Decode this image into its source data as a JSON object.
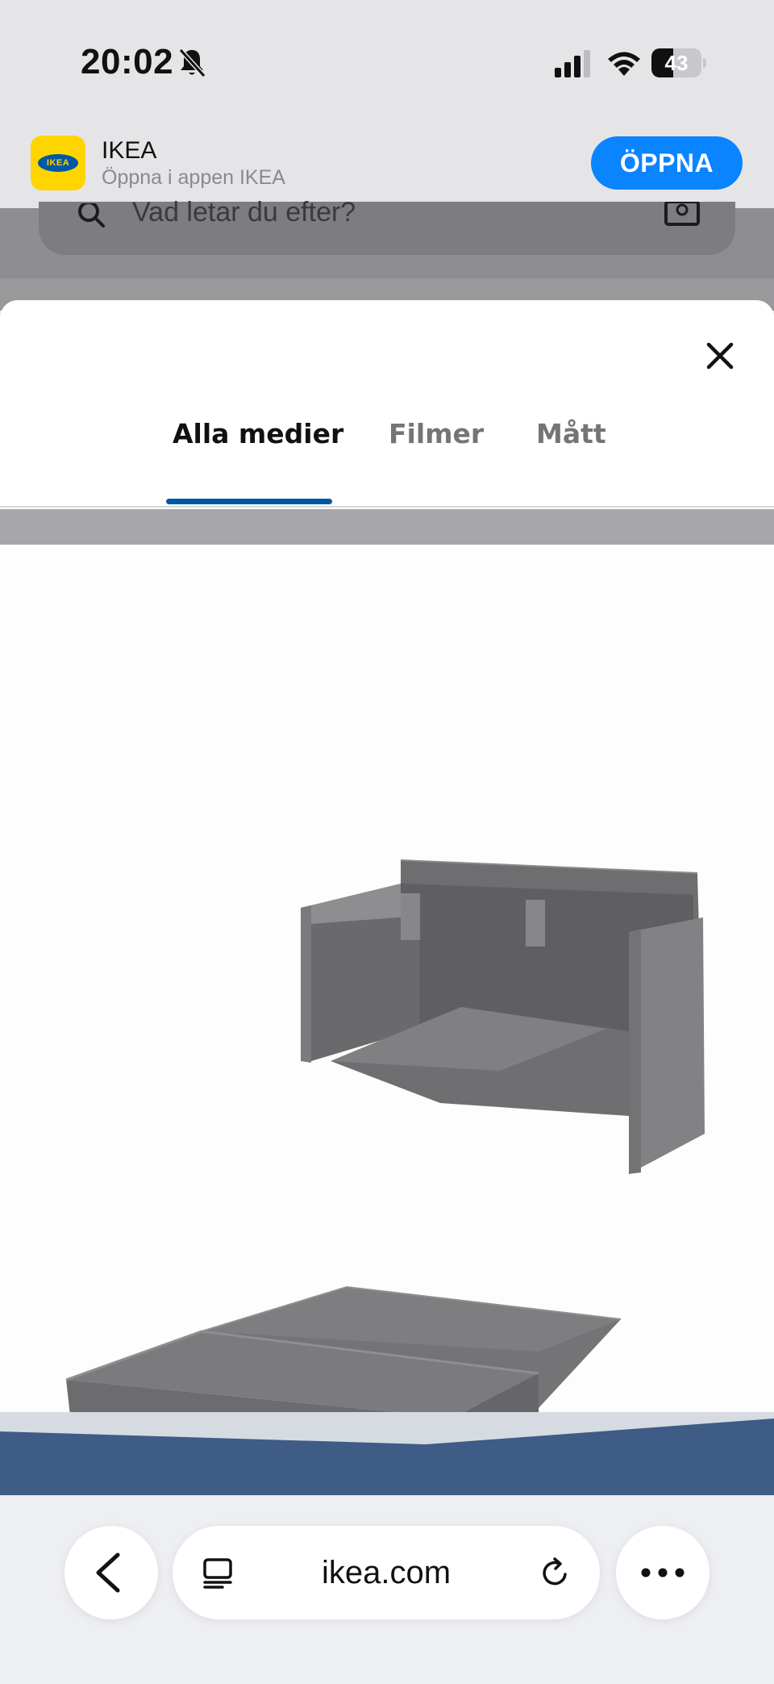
{
  "status_bar": {
    "time": "20:02",
    "battery_level": "43",
    "battery_fraction": 0.43
  },
  "app_banner": {
    "app_name": "IKEA",
    "subtitle": "Öppna i appen IKEA",
    "logo_text": "IKEA",
    "open_label": "ÖPPNA"
  },
  "background_page": {
    "search_placeholder": "Vad letar du efter?"
  },
  "modal": {
    "tabs": [
      {
        "label": "Alla medier",
        "active": true
      },
      {
        "label": "Filmer",
        "active": false
      },
      {
        "label": "Mått",
        "active": false
      }
    ]
  },
  "browser": {
    "url": "ikea.com"
  },
  "colors": {
    "accent_blue": "#0058a3",
    "open_button": "#0a84ff",
    "ikea_yellow": "#ffd500",
    "sofa_gray": "#7a7a7c",
    "room_wall": "#3e5c85"
  },
  "icons": {
    "silent": "bell-slash-icon",
    "signal": "cellular-signal-icon",
    "wifi": "wifi-icon",
    "close": "close-icon",
    "back": "chevron-left-icon",
    "reader": "reader-mode-icon",
    "reload": "reload-icon",
    "more": "more-dots-icon"
  }
}
